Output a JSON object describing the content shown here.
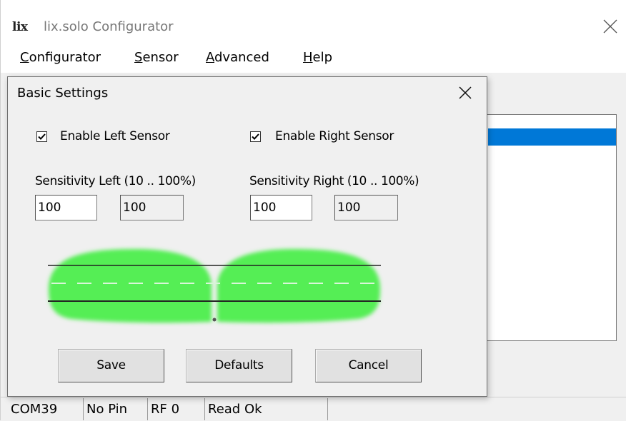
{
  "app": {
    "logo": "lix",
    "title": "lix.solo Configurator"
  },
  "menu": [
    {
      "label_u": "C",
      "label_rest": "onfigurator"
    },
    {
      "label_u": "S",
      "label_rest": "ensor"
    },
    {
      "label_u": "A",
      "label_rest": "dvanced"
    },
    {
      "label_u": "H",
      "label_rest": "elp"
    }
  ],
  "dialog": {
    "title": "Basic Settings",
    "enable_left": {
      "label": "Enable Left Sensor",
      "checked": true
    },
    "enable_right": {
      "label": "Enable Right Sensor",
      "checked": true
    },
    "sensitivity_left": {
      "label": "Sensitivity Left (10 .. 100%)",
      "value": "100",
      "current": "100"
    },
    "sensitivity_right": {
      "label": "Sensitivity Right (10 .. 100%)",
      "value": "100",
      "current": "100"
    },
    "buttons": {
      "save": "Save",
      "defaults": "Defaults",
      "cancel": "Cancel"
    }
  },
  "status": [
    "COM39",
    "No Pin",
    "RF 0",
    "Read Ok"
  ],
  "colors": {
    "accent": "#0078d7",
    "sensor_zone": "#55ee55"
  },
  "icons": {
    "close": "close-icon",
    "check": "check-icon"
  }
}
